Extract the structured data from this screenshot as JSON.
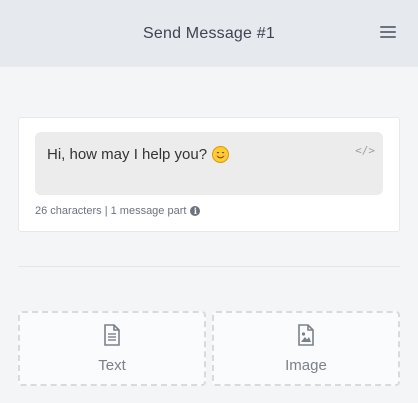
{
  "header": {
    "title": "Send Message #1",
    "menu_icon": "menu-icon"
  },
  "message": {
    "text": "Hi, how may I help you?",
    "emoji": "smiling-face-emoji",
    "code_toggle": "</>",
    "meta": "26 characters | 1 message part",
    "info_icon": "i"
  },
  "add_block": {
    "text_label": "Text",
    "image_label": "Image",
    "text_icon": "document-icon",
    "image_icon": "image-icon"
  },
  "colors": {
    "header_bg": "#e6e9ed",
    "page_bg": "#f4f5f7",
    "bubble_bg": "#ececec",
    "tile_border": "#d7dadf"
  }
}
